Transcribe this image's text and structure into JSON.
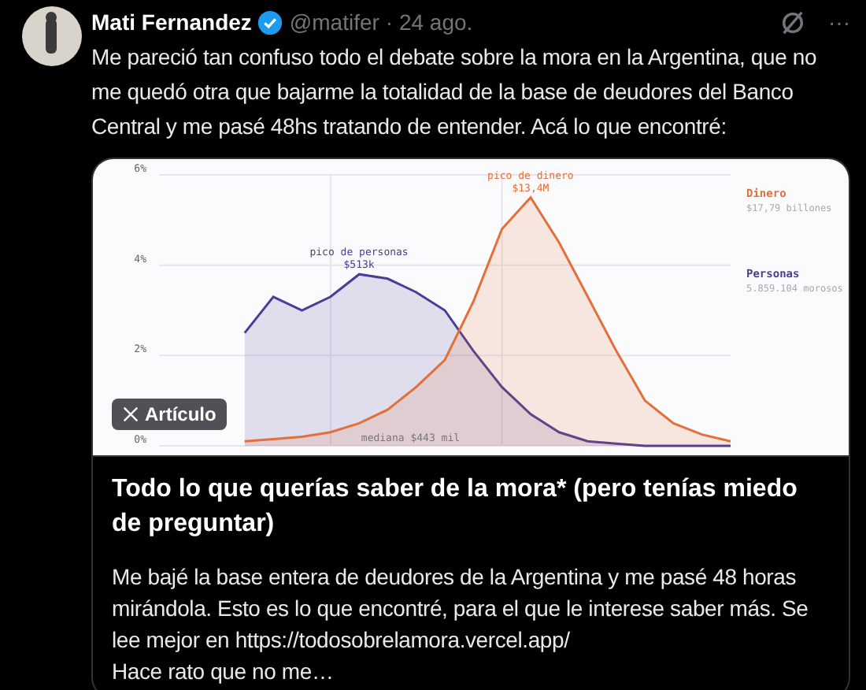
{
  "tweet": {
    "name": "Mati Fernandez",
    "verified": true,
    "handle": "@matifer",
    "date": "· 24 ago.",
    "more": "···",
    "text": "Me pareció tan confuso todo el debate sobre la mora en la Argentina, que no me quedó otra que bajarme la totalidad de la base de deudores del Banco Central y me pasé 48hs tratando de entender. Acá lo que encontré:"
  },
  "card": {
    "badge": "Artículo",
    "title": "Todo lo que querías saber de la mora* (pero tenías miedo de preguntar)",
    "description": "Me bajé la base entera de deudores de la Argentina y me pasé 48 horas mirándola. Esto es lo que encontré, para el que le interese saber más. Se lee mejor en https://todosobrelamora.vercel.app/\nHace rato que no me…",
    "legend": [
      {
        "detail": "$17,79 billones"
      },
      {
        "detail": "5.859.104 morosos"
      }
    ],
    "notes": [
      {
        "kind": "peak",
        "lines": [
          "pico de personas",
          "$513k"
        ]
      },
      {
        "kind": "peak",
        "lines": [
          "pico de dinero",
          "$13,4M"
        ]
      },
      {
        "kind": "median",
        "lines": [
          "mediana $443 mil"
        ]
      }
    ],
    "chart_data": {
      "type": "area",
      "grid": true,
      "ylim": [
        0,
        6
      ],
      "yticks": [
        {
          "value": 0,
          "label": "0%"
        },
        {
          "value": 2,
          "label": "2%"
        },
        {
          "value": 4,
          "label": "4%"
        },
        {
          "value": 6,
          "label": "6%"
        }
      ],
      "series": [
        {
          "name": "Personas",
          "color": "#4b3c96",
          "values": [
            null,
            null,
            null,
            2.5,
            3.3,
            3.0,
            3.3,
            3.8,
            3.7,
            3.4,
            3.0,
            2.1,
            1.3,
            0.7,
            0.3,
            0.1,
            0.05,
            0,
            0,
            0,
            0
          ]
        },
        {
          "name": "Dinero",
          "color": "#e2703a",
          "values": [
            null,
            null,
            null,
            0.1,
            0.15,
            0.2,
            0.3,
            0.5,
            0.8,
            1.3,
            1.9,
            3.2,
            4.8,
            5.5,
            4.5,
            3.3,
            2.1,
            1.0,
            0.5,
            0.25,
            0.1
          ]
        }
      ]
    }
  }
}
